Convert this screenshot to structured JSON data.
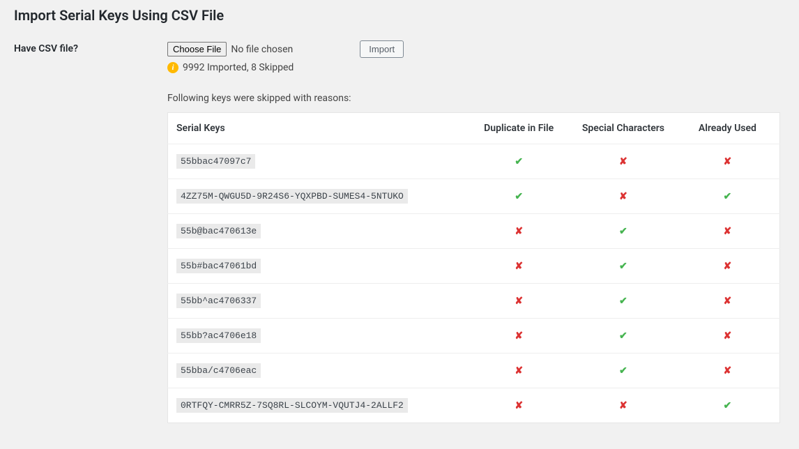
{
  "page": {
    "title": "Import Serial Keys Using CSV File"
  },
  "form": {
    "label": "Have CSV file?",
    "choose_file_label": "Choose File",
    "no_file_text": "No file chosen",
    "import_label": "Import"
  },
  "status": {
    "message": "9992 Imported, 8 Skipped"
  },
  "skipped_section": {
    "intro": "Following keys were skipped with reasons:",
    "headers": {
      "serial": "Serial Keys",
      "duplicate": "Duplicate in File",
      "special": "Special Characters",
      "used": "Already Used"
    },
    "rows": [
      {
        "key": "55bbac47097c7",
        "duplicate": true,
        "special": false,
        "used": false
      },
      {
        "key": "4ZZ75M-QWGU5D-9R24S6-YQXPBD-SUMES4-5NTUKO",
        "duplicate": true,
        "special": false,
        "used": true
      },
      {
        "key": "55b@bac470613e",
        "duplicate": false,
        "special": true,
        "used": false
      },
      {
        "key": "55b#bac47061bd",
        "duplicate": false,
        "special": true,
        "used": false
      },
      {
        "key": "55bb^ac4706337",
        "duplicate": false,
        "special": true,
        "used": false
      },
      {
        "key": "55bb?ac4706e18",
        "duplicate": false,
        "special": true,
        "used": false
      },
      {
        "key": "55bba/c4706eac",
        "duplicate": false,
        "special": true,
        "used": false
      },
      {
        "key": "0RTFQY-CMRR5Z-7SQ8RL-SLCOYM-VQUTJ4-2ALLF2",
        "duplicate": false,
        "special": false,
        "used": true
      }
    ]
  },
  "glyphs": {
    "yes": "✔",
    "no": "✘"
  }
}
